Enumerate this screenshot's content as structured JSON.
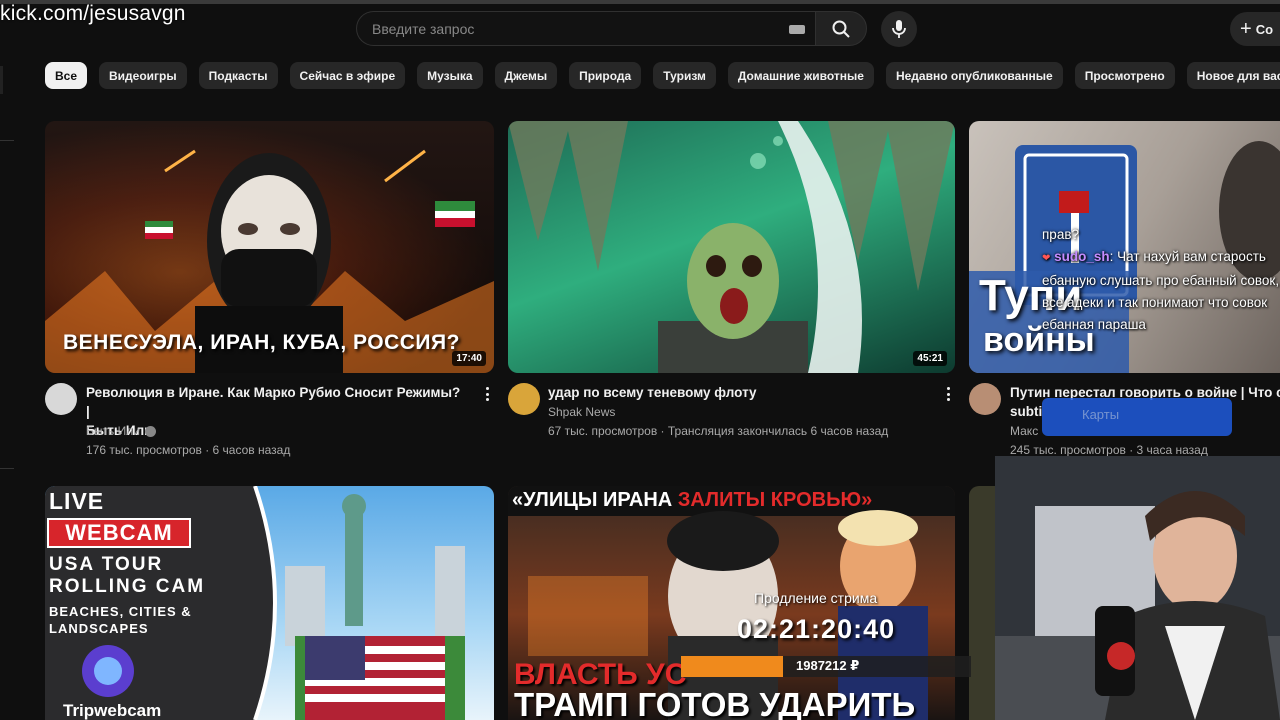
{
  "overlay": {
    "watermark": "kick.com/jesusavgn"
  },
  "header": {
    "search_placeholder": "Введите запрос",
    "create_label": "Со"
  },
  "chips": [
    "Все",
    "Видеоигры",
    "Подкасты",
    "Сейчас в эфире",
    "Музыка",
    "Джемы",
    "Природа",
    "Туризм",
    "Домашние животные",
    "Недавно опубликованные",
    "Просмотрено",
    "Новое для вас"
  ],
  "videos": [
    {
      "thumb_text": "ВЕНЕСУЭЛА, ИРАН, КУБА, РОССИЯ?",
      "duration": "17:40",
      "title_line1": "Революция в Иране. Как Марко Рубио Сносит Режимы? |",
      "title_line2": "Быть Или",
      "channel": "Быть Или",
      "meta": "176 тыс. просмотров · 6 часов назад"
    },
    {
      "duration": "45:21",
      "title_line1": "удар по всему теневому флоту",
      "channel": "Shpak News",
      "meta": "67 тыс. просмотров · Трансляция закончилась 6 часов назад"
    },
    {
      "thumb_text_1": "Тупи",
      "thumb_text_2": "войны",
      "title_line1": "Путин перестал говорить о войне | Что сл",
      "title_line2": "subti",
      "channel": "Макс",
      "meta": "245 тыс. просмотров · 3 часа назад"
    }
  ],
  "row2": {
    "live_label": "LIVE",
    "webcam_label": "WEBCAM",
    "usa_line1": "USA TOUR",
    "usa_line2": "ROLLING CAM",
    "usa_line3": "BEACHES, CITIES &",
    "usa_line4": "LANDSCAPES",
    "brand": "Tripwebcam",
    "iran_header_1": "«УЛИЦЫ ИРАНА",
    "iran_header_2": "ЗАЛИТЫ КРОВЬЮ»",
    "iran_line1": "ВЛАСТЬ УС",
    "iran_line2": "ТРАМП ГОТОВ УДАРИТЬ"
  },
  "chat": {
    "line0": "прав?",
    "user": "sudo_sh",
    "message": ": Чат нахуй вам старость ебанную слушать про ебанный совок, все адеки и так понимают что совок ебанная параша",
    "box_text": "Карты"
  },
  "stream": {
    "timer_label": "Продление стрима",
    "timer": "02:21:20:40",
    "donation_value": "1987212 ₽",
    "donation_fill_fraction": 0.35
  },
  "colors": {
    "accent_orange": "#f08a1c",
    "chat_user": "#c58cff"
  }
}
